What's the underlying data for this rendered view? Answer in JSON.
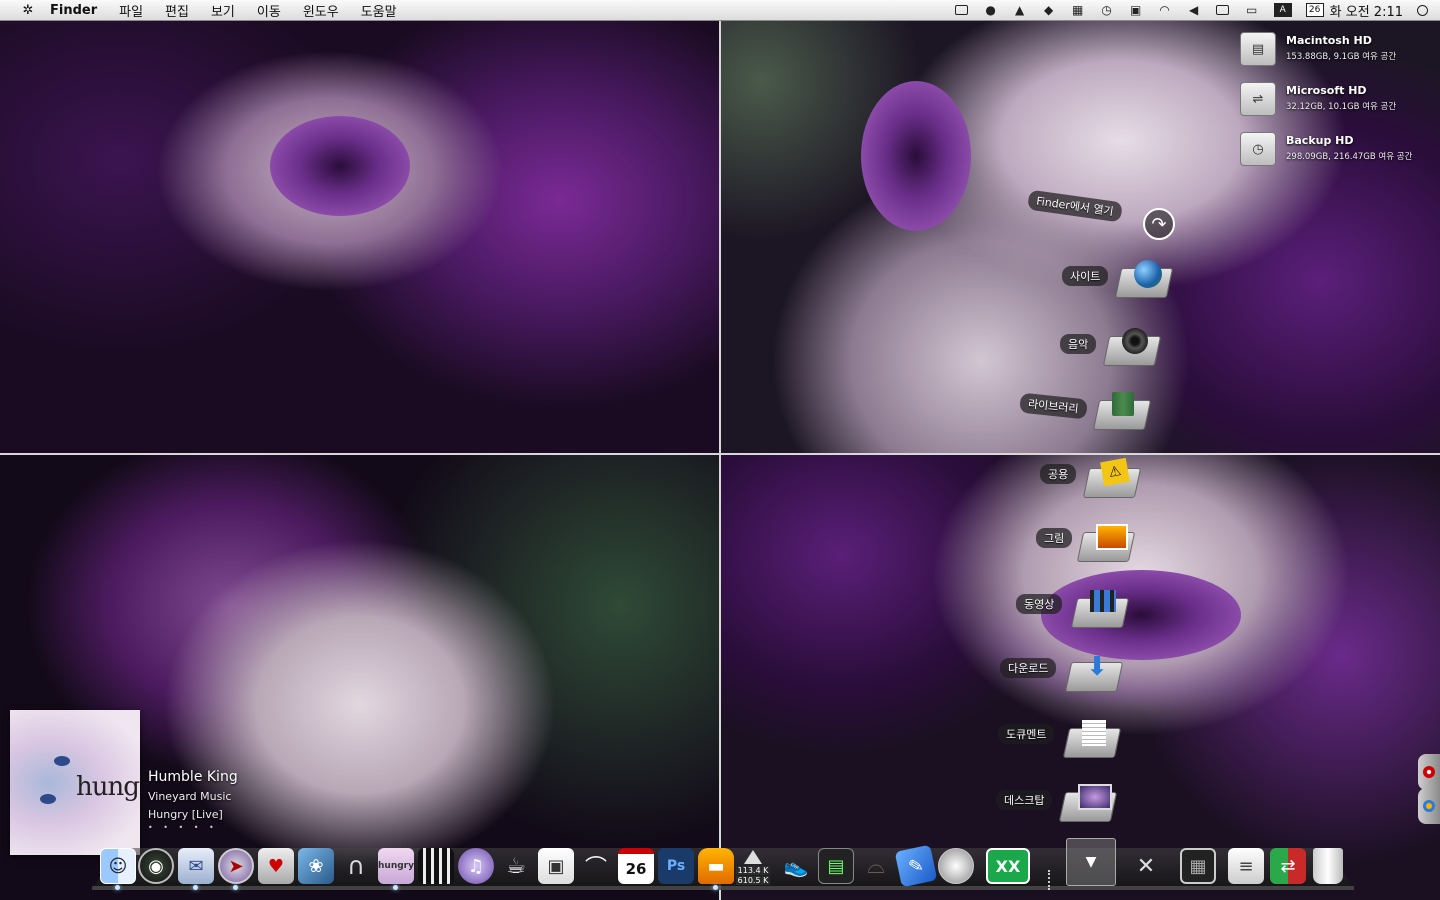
{
  "menubar": {
    "app_name": "Finder",
    "menus": [
      "파일",
      "편집",
      "보기",
      "이동",
      "윈도우",
      "도움말"
    ],
    "calendar_day": "26",
    "input_method": "A",
    "clock": "화 오전 2:11",
    "status_icons": [
      "screen-icon",
      "chat-icon",
      "user-icon",
      "evernote-icon",
      "spaces-icon",
      "time-machine-icon",
      "menu-extra-icon",
      "wifi-icon",
      "volume-icon",
      "display-icon",
      "battery-icon"
    ]
  },
  "drives": [
    {
      "name": "Macintosh HD",
      "info": "153.88GB, 9.1GB 여유 공간",
      "icon": "hard-drive-icon"
    },
    {
      "name": "Microsoft HD",
      "info": "32.12GB, 10.1GB 여유 공간",
      "icon": "usb-drive-icon"
    },
    {
      "name": "Backup HD",
      "info": "298.09GB, 216.47GB 여유 공간",
      "icon": "time-machine-drive-icon"
    }
  ],
  "stack": {
    "open_in_finder": "Finder에서 열기",
    "items": [
      {
        "label": "사이트",
        "icon": "sites-folder-icon"
      },
      {
        "label": "음악",
        "icon": "music-folder-icon"
      },
      {
        "label": "라이브러리",
        "icon": "library-folder-icon"
      },
      {
        "label": "공용",
        "icon": "public-folder-icon"
      },
      {
        "label": "그림",
        "icon": "pictures-folder-icon"
      },
      {
        "label": "동영상",
        "icon": "movies-folder-icon"
      },
      {
        "label": "다운로드",
        "icon": "downloads-folder-icon"
      },
      {
        "label": "도큐멘트",
        "icon": "documents-folder-icon"
      },
      {
        "label": "데스크탑",
        "icon": "desktop-folder-icon"
      }
    ]
  },
  "now_playing": {
    "track": "Humble King",
    "artist": "Vineyard Music",
    "album": "Hungry [Live]",
    "album_art_title": "hungry",
    "rating_dots": "• • • • •"
  },
  "dock": {
    "network_up": "113.4 K",
    "network_down": "610.5 K",
    "ical_day": "26",
    "apps": [
      "finder",
      "dashboard",
      "mail",
      "safari",
      "tuneup",
      "iphoto",
      "headphones",
      "itunes-album",
      "imovie",
      "itunes-visualizer",
      "caffeine",
      "polaroid",
      "stylebook",
      "ical",
      "photoshop",
      "transmit",
      "network-monitor",
      "sneaker",
      "activity",
      "hat",
      "pages",
      "dvd",
      "excel",
      "stack-arrow",
      "applications",
      "photobooth",
      "documents",
      "photo-manager",
      "trash"
    ]
  },
  "side_dock": [
    "record-icon",
    "globe-icon"
  ]
}
